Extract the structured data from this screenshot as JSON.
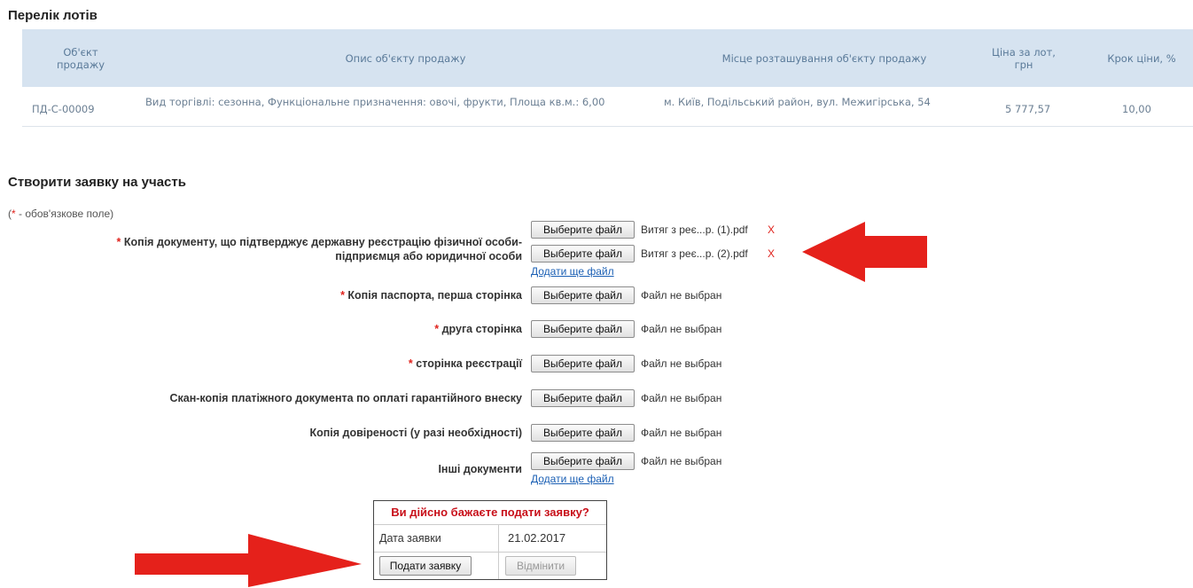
{
  "lots": {
    "title": "Перелік лотів",
    "columns": [
      "Об'єкт продажу",
      "Опис об'єкту продажу",
      "Місце розташування об'єкту продажу",
      "Ціна за лот, грн",
      "Крок ціни, %"
    ],
    "rows": [
      {
        "object": "ПД-С-00009",
        "description": "Вид торгівлі: сезонна, Функціональне призначення: овочі, фрукти, Площа кв.м.: 6,00",
        "location": "м. Київ, Подільський район, вул. Межигірська, 54",
        "price": "5 777,57",
        "step": "10,00"
      }
    ]
  },
  "form": {
    "title": "Створити заявку на участь",
    "required_note_star": "*",
    "required_note_prefix": "(",
    "required_note_text": " - обов'язкове поле)",
    "required_mark": "*",
    "choose_file_label": "Выберите файл",
    "no_file_text": "Файл не выбран",
    "add_file_label": "Додати ще файл",
    "remove_label": "X",
    "fields": {
      "registration": {
        "label_line1": "Копія документу, що підтверджує державну реєстрацію фізичної особи-",
        "label_line2": "підприємця або юридичної особи",
        "files": [
          "Витяг з реє...р. (1).pdf",
          "Витяг з реє...р. (2).pdf"
        ]
      },
      "passport_first": {
        "label": "Копія паспорта, перша сторінка"
      },
      "passport_second": {
        "label": "друга сторінка"
      },
      "passport_registration": {
        "label": "сторінка реєстрації"
      },
      "payment_scan": {
        "label": "Скан-копія платіжного документа по оплаті гарантійного внеску"
      },
      "power_of_attorney": {
        "label": "Копія довіреності (у разі необхідності)"
      },
      "other_docs": {
        "label": "Інші документи"
      }
    }
  },
  "confirm": {
    "question": "Ви дійсно бажаєте подати заявку?",
    "date_label": "Дата заявки",
    "date_value": "21.02.2017",
    "submit_label": "Подати заявку",
    "cancel_label": "Відмінити"
  },
  "colors": {
    "required": "#e0231d",
    "arrow": "#e5211b",
    "table_header": "#d6e3f0",
    "link": "#1a5fb4"
  }
}
